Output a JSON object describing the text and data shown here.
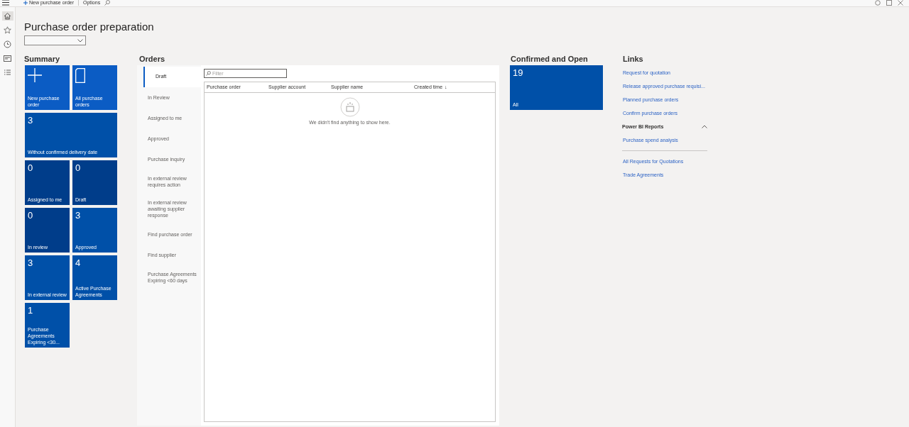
{
  "toolbar": {
    "new_button": "New purchase order",
    "options_tab": "Options"
  },
  "nav_rail": [
    {
      "kind": "home",
      "selected": true
    },
    {
      "kind": "star",
      "selected": false
    },
    {
      "kind": "clock",
      "selected": false
    },
    {
      "kind": "workspace",
      "selected": false
    },
    {
      "kind": "list",
      "selected": false
    }
  ],
  "page_title": "Purchase order preparation",
  "summary": {
    "heading": "Summary",
    "tiles": [
      {
        "kind": "new",
        "label": "New purchase order",
        "color": "#0b5cc4"
      },
      {
        "kind": "document",
        "label": "All purchase orders",
        "color": "#0b5cc4"
      },
      {
        "kind": "wide_count",
        "count": "3",
        "label": "Without confirmed delivery date",
        "color": "#0050a8"
      },
      {
        "kind": "count",
        "count": "0",
        "label": "Assigned to me",
        "color": "#003d8a"
      },
      {
        "kind": "count",
        "count": "0",
        "label": "Draft",
        "color": "#003d8a"
      },
      {
        "kind": "count",
        "count": "0",
        "label": "In review",
        "color": "#003d8a"
      },
      {
        "kind": "count",
        "count": "3",
        "label": "Approved",
        "color": "#0050a8"
      },
      {
        "kind": "count",
        "count": "3",
        "label": "In external review",
        "color": "#0050a8"
      },
      {
        "kind": "count",
        "count": "4",
        "label": "Active Purchase Agreements",
        "color": "#0050a8"
      },
      {
        "kind": "count",
        "count": "1",
        "label": "Purchase Agreements Expiring <30...",
        "color": "#0050a8"
      }
    ]
  },
  "orders": {
    "heading": "Orders",
    "tabs": [
      {
        "label": "Draft",
        "selected": true
      },
      {
        "label": "In Review",
        "selected": false
      },
      {
        "label": "Assigned to me",
        "selected": false
      },
      {
        "label": "Approved",
        "selected": false
      },
      {
        "label": "Purchase inquiry",
        "selected": false
      },
      {
        "label": "In external review requires action",
        "selected": false
      },
      {
        "label": "In external review awaiting supplier response",
        "selected": false
      },
      {
        "label": "Find purchase order",
        "selected": false
      },
      {
        "label": "Find supplier",
        "selected": false
      },
      {
        "label": "Purchase Agreements Expiring <60 days",
        "selected": false
      }
    ],
    "filter": {
      "placeholder": "Filter"
    },
    "table": {
      "columns": [
        "Purchase order",
        "Supplier account",
        "Supplier name",
        "Created time"
      ],
      "sort_mark": "↓",
      "empty_message": "We didn't find anything to show here."
    }
  },
  "confirmed_open": {
    "heading": "Confirmed and Open",
    "tile": {
      "count": "19",
      "label": "All",
      "color": "#0050a8"
    }
  },
  "links": {
    "heading": "Links",
    "items": [
      {
        "kind": "link",
        "label": "Request for quotation"
      },
      {
        "kind": "link",
        "label": "Release approved purchase requisi..."
      },
      {
        "kind": "link",
        "label": "Planned purchase orders"
      },
      {
        "kind": "link",
        "label": "Confirm purchase orders"
      },
      {
        "kind": "group",
        "label": "Power BI Reports",
        "expanded": true
      },
      {
        "kind": "link",
        "label": "Purchase spend analysis"
      },
      {
        "kind": "divider"
      },
      {
        "kind": "link",
        "label": "All Requests for Quotations"
      },
      {
        "kind": "link",
        "label": "Trade Agreements"
      }
    ]
  }
}
